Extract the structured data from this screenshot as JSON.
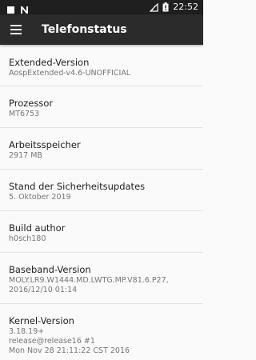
{
  "status_bar": {
    "time": "22:52",
    "icons": [
      "notification-n-icon",
      "no-signal-icon",
      "battery-icon"
    ]
  },
  "toolbar": {
    "title": "Telefonstatus",
    "menu_icon": "hamburger-menu-icon"
  },
  "items": [
    {
      "title": "Extended-Version",
      "summary": "AospExtended-v4.6-UNOFFICIAL"
    },
    {
      "title": "Prozessor",
      "summary": "MT6753"
    },
    {
      "title": "Arbeitsspeicher",
      "summary": "2917 MB"
    },
    {
      "title": "Stand der Sicherheitsupdates",
      "summary": "5. Oktober 2019"
    },
    {
      "title": "Build author",
      "summary": "h0sch180"
    },
    {
      "title": "Baseband-Version",
      "summary": "MOLY.LR9.W1444.MD.LWTG.MP.V81.6.P27,\n2016/12/10 01:14"
    },
    {
      "title": "Kernel-Version",
      "summary": "3.18.19+\nrelease@release16 #1\nMon Nov 28 21:11:22 CST 2016"
    }
  ],
  "colors": {
    "status_bar_bg": "#1f1f1f",
    "toolbar_bg": "#2b2b2b",
    "background": "#fafafa",
    "title_text": "#212121",
    "summary_text": "#757575"
  }
}
